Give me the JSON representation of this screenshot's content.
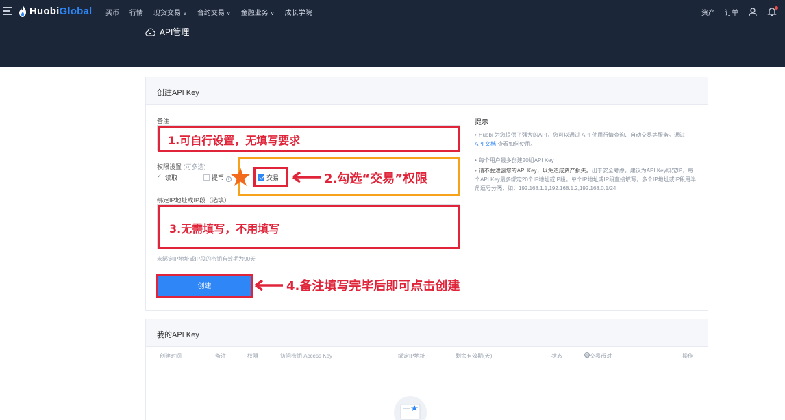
{
  "topbar": {
    "logo_main": "Huobi",
    "logo_accent": "Global",
    "nav": [
      "买币",
      "行情",
      "现货交易",
      "合约交易",
      "金融业务",
      "成长学院"
    ],
    "nav_dropdown": [
      false,
      false,
      true,
      true,
      true,
      false
    ],
    "right": [
      "资产",
      "订单"
    ]
  },
  "banner": {
    "title": "API管理"
  },
  "create": {
    "card_title": "创建API Key",
    "note_label": "备注",
    "perm_label": "权限设置",
    "perm_hint": "(可多选)",
    "perm_read": "读取",
    "perm_withdraw": "提币",
    "perm_trade": "交易",
    "ip_label": "绑定IP地址或IP段（选填）",
    "ip_hint": "未绑定IP地址或IP段的密钥有效期为90天",
    "create_button": "创建",
    "tips_title": "提示",
    "tip1_a": "Huobi 为您提供了强大的API，您可以通过 API 使用行情查询、自动交易等服务。通过",
    "tip1_link": "API 文档",
    "tip1_b": "查看如何使用。",
    "tip2": "每个用户最多创建20组API Key",
    "tip3_strong": "请不要泄露您的API Key，以免造成资产损失。",
    "tip3_rest": "出于安全考虑，建议为API Key绑定IP，每个API Key最多绑定20个IP地址或IP段。单个IP地址或IP段直接填写，多个IP地址或IP段用半角逗号分隔，如：192.168.1.1,192.168.1.2,192.168.0.1/24"
  },
  "annotations": {
    "a1": "1.可自行设置，无填写要求",
    "a2": "2.勾选“交易”权限",
    "a3": "3.无需填写，不用填写",
    "a4": "4.备注填写完毕后即可点击创建"
  },
  "my_api": {
    "card_title": "我的API Key",
    "columns": [
      "创建时间",
      "备注",
      "权限",
      "访问密钥 Access Key",
      "绑定IP地址",
      "剩余有效期(天)",
      "状态",
      "可交易币对",
      "操作"
    ]
  },
  "colors": {
    "nav_bg": "#1b2638",
    "accent": "#2f86f6",
    "annotation_red": "#e0253a",
    "annotation_orange": "#f7a21b"
  }
}
